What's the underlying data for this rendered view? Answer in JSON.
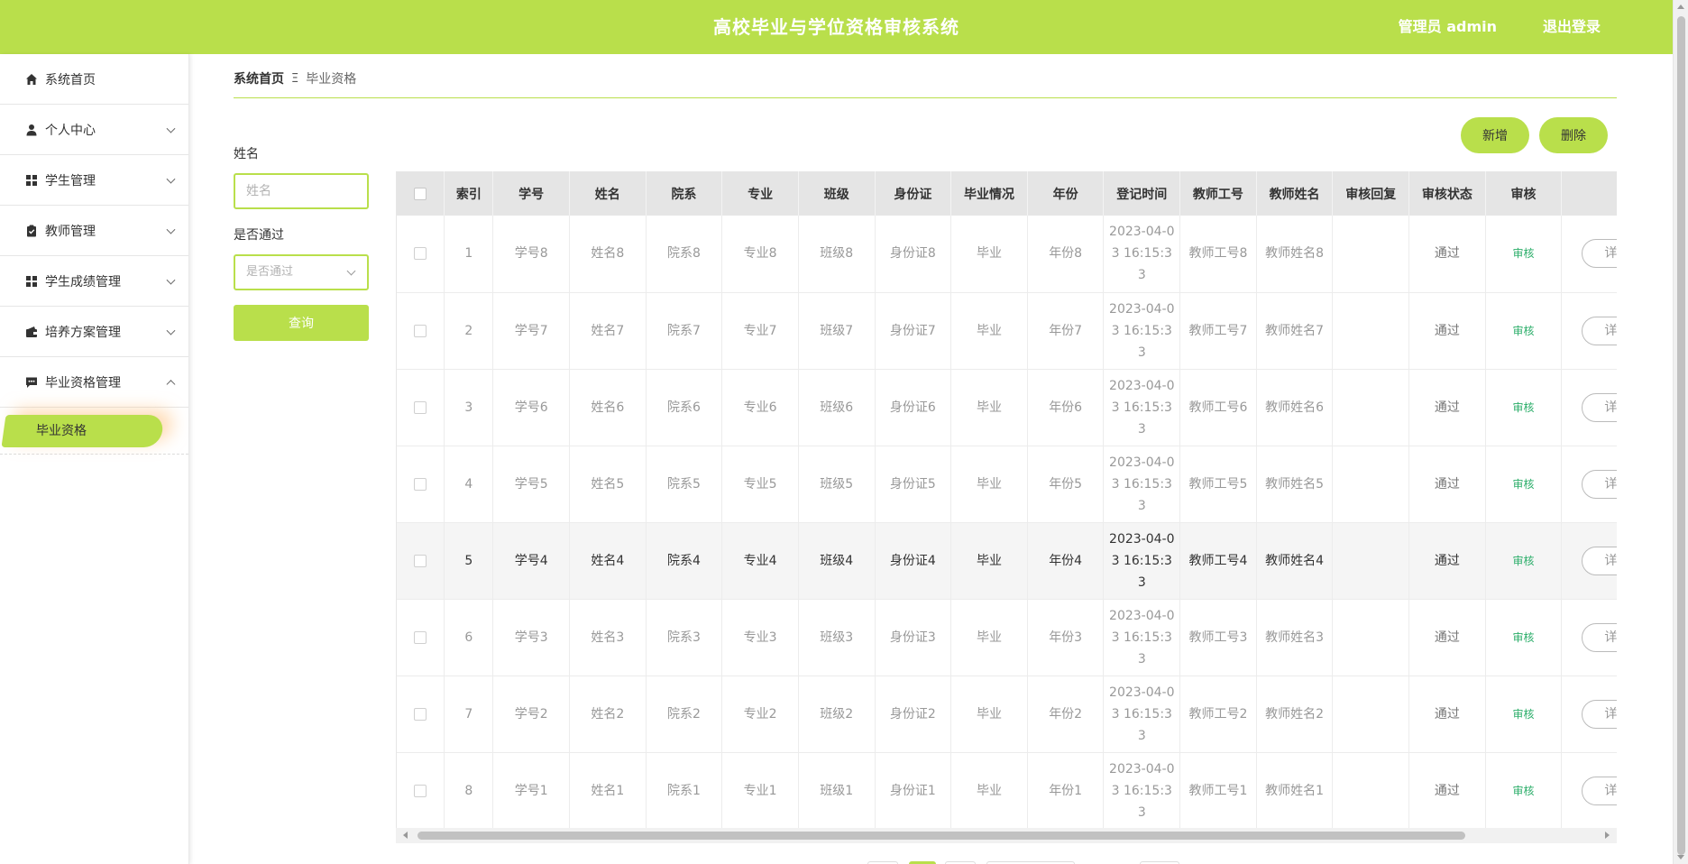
{
  "header": {
    "title": "高校毕业与学位资格审核系统",
    "admin_label": "管理员 admin",
    "logout_label": "退出登录"
  },
  "sidebar": {
    "items": [
      {
        "label": "系统首页",
        "icon": "home-icon"
      },
      {
        "label": "个人中心",
        "icon": "user-icon"
      },
      {
        "label": "学生管理",
        "icon": "grid-icon"
      },
      {
        "label": "教师管理",
        "icon": "clipboard-icon"
      },
      {
        "label": "学生成绩管理",
        "icon": "grid-icon"
      },
      {
        "label": "培养方案管理",
        "icon": "wallet-icon"
      },
      {
        "label": "毕业资格管理",
        "icon": "chat-icon"
      }
    ],
    "active_sub": "毕业资格"
  },
  "breadcrumb": {
    "home": "系统首页",
    "separator": "Ξ",
    "current": "毕业资格"
  },
  "filter": {
    "name_label": "姓名",
    "name_placeholder": "姓名",
    "pass_label": "是否通过",
    "pass_placeholder": "是否通过",
    "query_label": "查询"
  },
  "actions": {
    "add_label": "新增",
    "delete_label": "删除"
  },
  "table": {
    "columns": [
      "索引",
      "学号",
      "姓名",
      "院系",
      "专业",
      "班级",
      "身份证",
      "毕业情况",
      "年份",
      "登记时间",
      "教师工号",
      "教师姓名",
      "审核回复",
      "审核状态",
      "审核"
    ],
    "detail_label": "详情",
    "audit_label": "审核",
    "rows": [
      [
        "1",
        "学号8",
        "姓名8",
        "院系8",
        "专业8",
        "班级8",
        "身份证8",
        "毕业",
        "年份8",
        "2023-04-03 16:15:33",
        "教师工号8",
        "教师姓名8",
        "",
        "通过"
      ],
      [
        "2",
        "学号7",
        "姓名7",
        "院系7",
        "专业7",
        "班级7",
        "身份证7",
        "毕业",
        "年份7",
        "2023-04-03 16:15:33",
        "教师工号7",
        "教师姓名7",
        "",
        "通过"
      ],
      [
        "3",
        "学号6",
        "姓名6",
        "院系6",
        "专业6",
        "班级6",
        "身份证6",
        "毕业",
        "年份6",
        "2023-04-03 16:15:33",
        "教师工号6",
        "教师姓名6",
        "",
        "通过"
      ],
      [
        "4",
        "学号5",
        "姓名5",
        "院系5",
        "专业5",
        "班级5",
        "身份证5",
        "毕业",
        "年份5",
        "2023-04-03 16:15:33",
        "教师工号5",
        "教师姓名5",
        "",
        "通过"
      ],
      [
        "5",
        "学号4",
        "姓名4",
        "院系4",
        "专业4",
        "班级4",
        "身份证4",
        "毕业",
        "年份4",
        "2023-04-03 16:15:33",
        "教师工号4",
        "教师姓名4",
        "",
        "通过"
      ],
      [
        "6",
        "学号3",
        "姓名3",
        "院系3",
        "专业3",
        "班级3",
        "身份证3",
        "毕业",
        "年份3",
        "2023-04-03 16:15:33",
        "教师工号3",
        "教师姓名3",
        "",
        "通过"
      ],
      [
        "7",
        "学号2",
        "姓名2",
        "院系2",
        "专业2",
        "班级2",
        "身份证2",
        "毕业",
        "年份2",
        "2023-04-03 16:15:33",
        "教师工号2",
        "教师姓名2",
        "",
        "通过"
      ],
      [
        "8",
        "学号1",
        "姓名1",
        "院系1",
        "专业1",
        "班级1",
        "身份证1",
        "毕业",
        "年份1",
        "2023-04-03 16:15:33",
        "教师工号1",
        "教师姓名1",
        "",
        "通过"
      ]
    ],
    "hover_row": 4
  },
  "colors": {
    "accent": "#b9df4b",
    "audit_link": "#2cae6a"
  }
}
